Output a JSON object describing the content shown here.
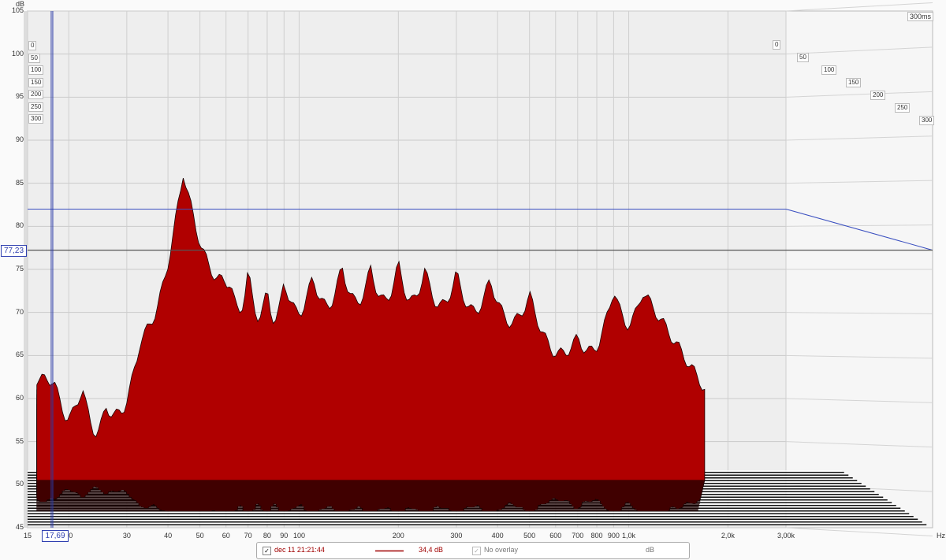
{
  "chart_data": {
    "type": "waterfall",
    "ylabel": "dB",
    "xlabel": "Hz",
    "ylim": [
      45,
      105
    ],
    "xlim": [
      15,
      3000
    ],
    "x_scale": "log",
    "y_ticks": [
      "105",
      "100",
      "95",
      "90",
      "85",
      "80",
      "75",
      "70",
      "65",
      "60",
      "55",
      "50",
      "45"
    ],
    "x_ticks": [
      {
        "v": 15,
        "t": "15"
      },
      {
        "v": 20,
        "t": "20"
      },
      {
        "v": 30,
        "t": "30"
      },
      {
        "v": 40,
        "t": "40"
      },
      {
        "v": 50,
        "t": "50"
      },
      {
        "v": 60,
        "t": "60"
      },
      {
        "v": 70,
        "t": "70"
      },
      {
        "v": 80,
        "t": "80"
      },
      {
        "v": 90,
        "t": "90"
      },
      {
        "v": 100,
        "t": "100"
      },
      {
        "v": 200,
        "t": "200"
      },
      {
        "v": 300,
        "t": "300"
      },
      {
        "v": 400,
        "t": "400"
      },
      {
        "v": 500,
        "t": "500"
      },
      {
        "v": 600,
        "t": "600"
      },
      {
        "v": 700,
        "t": "700"
      },
      {
        "v": 800,
        "t": "800"
      },
      {
        "v": 900,
        "t": "900"
      },
      {
        "v": 1000,
        "t": "1,0k"
      },
      {
        "v": 2000,
        "t": "2,0k"
      },
      {
        "v": 3000,
        "t": "3,00k"
      }
    ],
    "time_axis": {
      "labels": [
        "0",
        "50",
        "100",
        "150",
        "200",
        "250",
        "300"
      ],
      "max_label": "300ms"
    },
    "cursor": {
      "freq_label": "17,69",
      "level_label": "77,23",
      "freq": 17.69,
      "level": 77.23,
      "threshold_db": 82
    },
    "series_color": "#b00000",
    "first_slice_peaks": [
      {
        "hz": 18,
        "db": 62.2
      },
      {
        "hz": 22,
        "db": 61.5
      },
      {
        "hz": 26,
        "db": 59
      },
      {
        "hz": 33,
        "db": 66.8
      },
      {
        "hz": 44.5,
        "db": 86.3
      },
      {
        "hz": 62,
        "db": 73.5
      },
      {
        "hz": 70,
        "db": 74.8
      },
      {
        "hz": 80,
        "db": 72.5
      },
      {
        "hz": 90,
        "db": 73.8
      },
      {
        "hz": 110,
        "db": 74.2
      },
      {
        "hz": 135,
        "db": 75.3
      },
      {
        "hz": 165,
        "db": 75.1
      },
      {
        "hz": 200,
        "db": 75.6
      },
      {
        "hz": 240,
        "db": 75.0
      },
      {
        "hz": 300,
        "db": 74.5
      },
      {
        "hz": 380,
        "db": 73.8
      },
      {
        "hz": 500,
        "db": 72.0
      },
      {
        "hz": 700,
        "db": 67.0
      },
      {
        "hz": 900,
        "db": 72.8
      },
      {
        "hz": 1100,
        "db": 72.5
      }
    ],
    "num_slices": 40
  },
  "legend": {
    "measurement_checked": "✓",
    "measurement": "dec 11 21:21:44",
    "level": "34,4 dB",
    "overlay_checked": "✓",
    "overlay": "No overlay",
    "unit": "dB"
  }
}
